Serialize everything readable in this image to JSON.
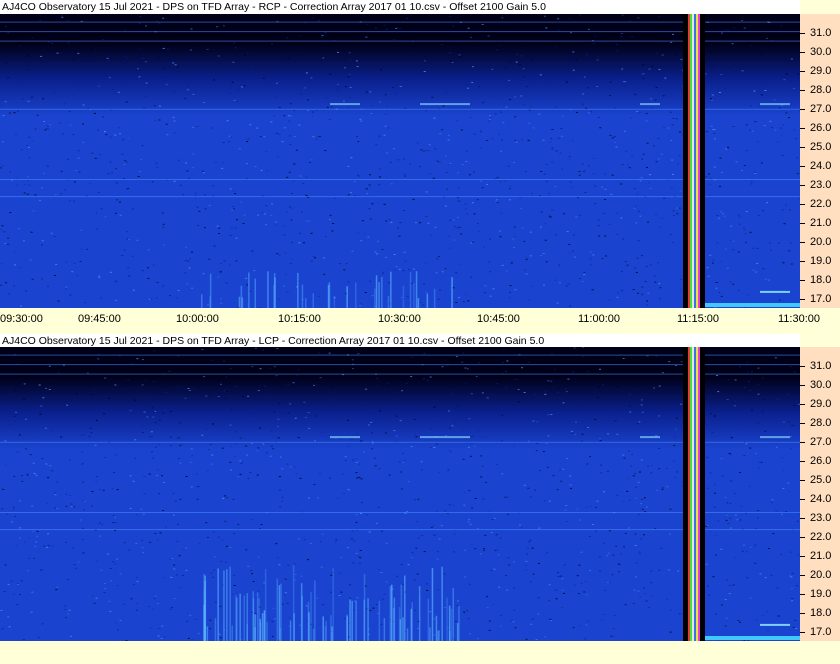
{
  "chart_data": [
    {
      "type": "heatmap",
      "title": "AJ4CO Observatory 15 Jul 2021  -  DPS on TFD Array  -  RCP  -  Correction Array 2017 01 10.csv  -  Offset 2100  Gain 5.0",
      "polarization": "RCP",
      "ylim": [
        16.5,
        32.0
      ],
      "yticks": [
        "31.0",
        "30.0",
        "29.0",
        "28.0",
        "27.0",
        "26.0",
        "25.0",
        "24.0",
        "23.0",
        "22.0",
        "21.0",
        "20.0",
        "19.0",
        "18.0",
        "17.0"
      ],
      "xticks": [
        "09:30:00",
        "09:45:00",
        "10:00:00",
        "10:15:00",
        "10:30:00",
        "10:45:00",
        "11:00:00",
        "11:15:00",
        "11:30:00"
      ],
      "colors": [
        "#000018",
        "#0a1f8c",
        "#1a44d0",
        "#4a8cff"
      ]
    },
    {
      "type": "heatmap",
      "title": "AJ4CO Observatory 15 Jul 2021  -  DPS on TFD Array  -  LCP  -  Correction Array 2017 01 10.csv  -  Offset 2100  Gain 5.0",
      "polarization": "LCP",
      "ylim": [
        16.5,
        32.0
      ],
      "yticks": [
        "31.0",
        "30.0",
        "29.0",
        "28.0",
        "27.0",
        "26.0",
        "25.0",
        "24.0",
        "23.0",
        "22.0",
        "21.0",
        "20.0",
        "19.0",
        "18.0",
        "17.0"
      ],
      "colors": [
        "#000018",
        "#0a1f8c",
        "#1a44d0",
        "#4a8cff"
      ]
    }
  ]
}
